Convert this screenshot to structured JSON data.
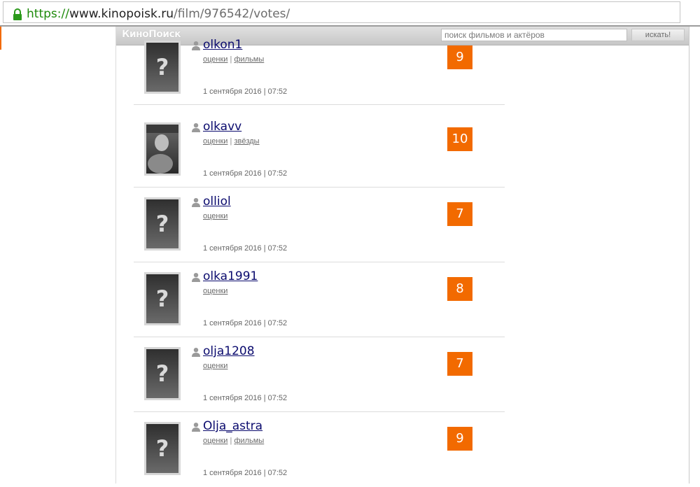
{
  "browser": {
    "url_scheme": "https://",
    "url_host": "www.kinopoisk.ru",
    "url_path": "/film/976542/votes/",
    "lock_icon": "lock-icon",
    "accent_color": "#1e8a0b"
  },
  "site": {
    "logo": "КиноПоиск",
    "search_placeholder": "поиск фильмов и актёров",
    "search_button": "искать!",
    "brand_color": "#f26a00"
  },
  "votes": [
    {
      "username": "olkon1",
      "link1": "оценки",
      "link2": "фильмы",
      "date": "1 сентября 2016 | 07:52",
      "rating": "9",
      "avatar": "placeholder",
      "avatar_glyph": "?"
    },
    {
      "username": "olkavv",
      "link1": "оценки",
      "link2": "звёзды",
      "date": "1 сентября 2016 | 07:52",
      "rating": "10",
      "avatar": "photo",
      "avatar_glyph": ""
    },
    {
      "username": "olliol",
      "link1": "оценки",
      "link2": "",
      "date": "1 сентября 2016 | 07:52",
      "rating": "7",
      "avatar": "placeholder",
      "avatar_glyph": "?"
    },
    {
      "username": "olka1991",
      "link1": "оценки",
      "link2": "",
      "date": "1 сентября 2016 | 07:52",
      "rating": "8",
      "avatar": "placeholder",
      "avatar_glyph": "?"
    },
    {
      "username": "olja1208",
      "link1": "оценки",
      "link2": "",
      "date": "1 сентября 2016 | 07:52",
      "rating": "7",
      "avatar": "placeholder",
      "avatar_glyph": "?"
    },
    {
      "username": "Olja_astra",
      "link1": "оценки",
      "link2": "фильмы",
      "date": "1 сентября 2016 | 07:52",
      "rating": "9",
      "avatar": "placeholder",
      "avatar_glyph": "?"
    }
  ],
  "separator": "|"
}
